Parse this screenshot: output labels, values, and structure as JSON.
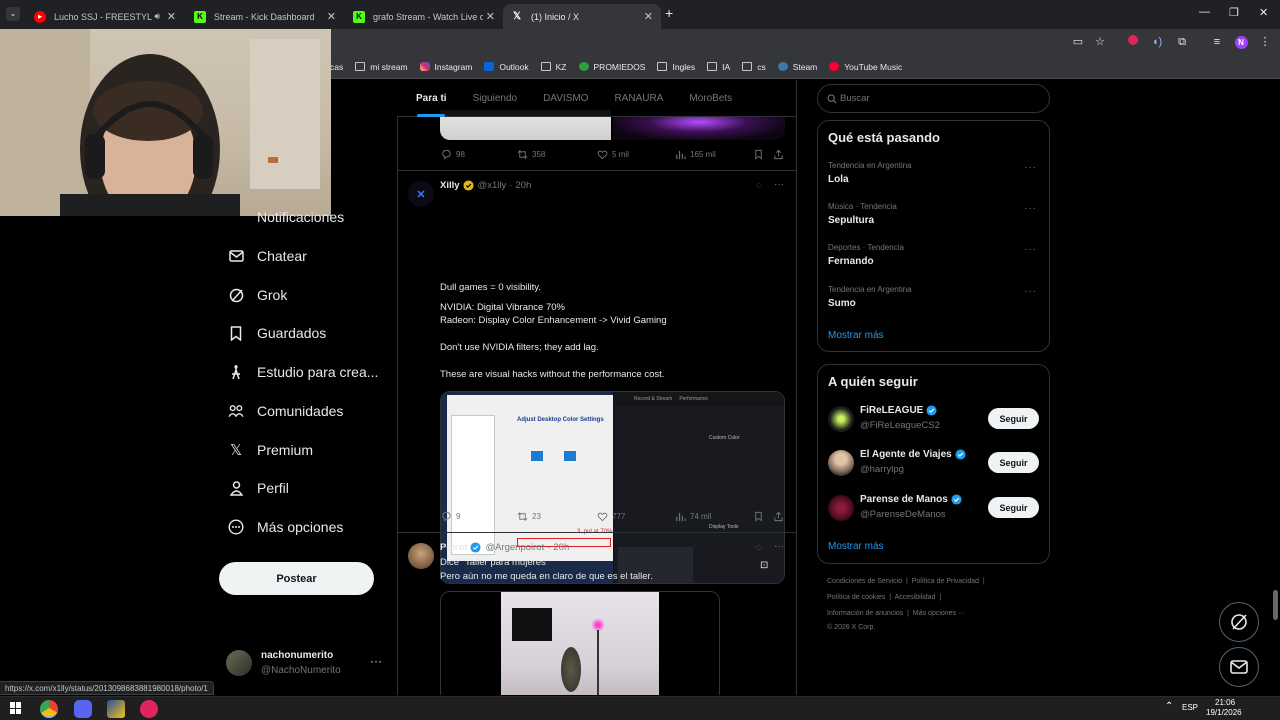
{
  "browser": {
    "tabs": [
      {
        "title": "Lucho SSJ - FREESTYLE - Yo",
        "favicon": "youtube-icon",
        "active": false
      },
      {
        "title": "Stream - Kick Dashboard",
        "favicon": "kick-icon",
        "active": false
      },
      {
        "title": "grafo Stream - Watch Live on K",
        "favicon": "kick-icon",
        "active": false
      },
      {
        "title": "(1) Inicio / X",
        "favicon": "x-icon",
        "active": true
      }
    ],
    "new_tab": "+",
    "profile_initial": "N",
    "bookmarks": [
      "cas",
      "mi stream",
      "Instagram",
      "Outlook",
      "KZ",
      "PROMIEDOS",
      "Ingles",
      "IA",
      "cs",
      "Steam",
      "YouTube Music"
    ],
    "status_url": "https://x.com/x1lly/status/2013098683881980018/photo/1"
  },
  "nav": {
    "items": [
      {
        "label": "Notificaciones",
        "icon": "bell-icon"
      },
      {
        "label": "Chatear",
        "icon": "mail-icon"
      },
      {
        "label": "Grok",
        "icon": "grok-icon"
      },
      {
        "label": "Guardados",
        "icon": "bookmark-icon"
      },
      {
        "label": "Estudio para crea...",
        "icon": "creator-studio-icon"
      },
      {
        "label": "Comunidades",
        "icon": "communities-icon"
      },
      {
        "label": "Premium",
        "icon": "x-logo-icon"
      },
      {
        "label": "Perfil",
        "icon": "person-icon"
      },
      {
        "label": "Más opciones",
        "icon": "more-circle-icon"
      }
    ],
    "post_button": "Postear",
    "account": {
      "name": "nachonumerito",
      "handle": "@NachoNumerito",
      "more": "···"
    }
  },
  "feed": {
    "tabs": [
      "Para ti",
      "Siguiendo",
      "DAVISMO",
      "RANAURA",
      "MoroBets"
    ],
    "active_tab": "Para ti",
    "top_actions": {
      "replies": "98",
      "reposts": "358",
      "likes": "5 mil",
      "views": "165 mil"
    },
    "tweet1": {
      "name": "Xilly",
      "handle": "@x1lly",
      "time": "20h",
      "lines": [
        "Dull games = 0 visibility.",
        "NVIDIA: Digital Vibrance 70%",
        "Radeon: Display Color Enhancement -> Vivid Gaming",
        "Don't use NVIDIA filters; they add lag.",
        "These are visual hacks without the performance cost."
      ],
      "image_left": {
        "title": "Adjust Desktop Color Settings",
        "note": "3. put at 70%"
      },
      "image_right": {
        "tabs": [
          "Record & Stream",
          "Performance"
        ],
        "section1": "Custom Color",
        "section2": "Display Tools"
      },
      "actions": {
        "replies": "9",
        "reposts": "23",
        "likes": "777",
        "views": "74 mil"
      }
    },
    "tweet2": {
      "name": "Poirot",
      "handle": "@Argenpoirot",
      "time": "20h",
      "lines": [
        "Dice \"Taller para mujeres\"",
        "Pero aún no me queda en claro de que es el taller."
      ]
    }
  },
  "sidebar": {
    "search_placeholder": "Buscar",
    "trends": {
      "title": "Qué está pasando",
      "items": [
        {
          "meta": "Tendencia en Argentina",
          "name": "Lola"
        },
        {
          "meta": "Música · Tendencia",
          "name": "Sepultura"
        },
        {
          "meta": "Deportes · Tendencia",
          "name": "Fernando"
        },
        {
          "meta": "Tendencia en Argentina",
          "name": "Sumo"
        }
      ],
      "more": "Mostrar más"
    },
    "follow": {
      "title": "A quién seguir",
      "items": [
        {
          "name": "FiReLEAGUE",
          "handle": "@FiReLeagueCS2",
          "button": "Seguir"
        },
        {
          "name": "El Agente de Viajes",
          "handle": "@harrylpg",
          "button": "Seguir"
        },
        {
          "name": "Parense de Manos",
          "handle": "@ParenseDeManos",
          "button": "Seguir"
        }
      ],
      "more": "Mostrar más"
    },
    "footer": {
      "links": [
        "Condiciones de Servicio",
        "Política de Privacidad",
        "Política de cookies",
        "Accesibilidad",
        "Información de anuncios",
        "Más opciones ···"
      ],
      "copyright": "© 2026 X Corp."
    }
  },
  "taskbar": {
    "lang": "ESP",
    "time": "21:06",
    "date": "19/1/2026"
  },
  "colors": {
    "accent": "#1d9bf0",
    "background": "#000000",
    "border": "#2f3336",
    "muted": "#71767b"
  }
}
